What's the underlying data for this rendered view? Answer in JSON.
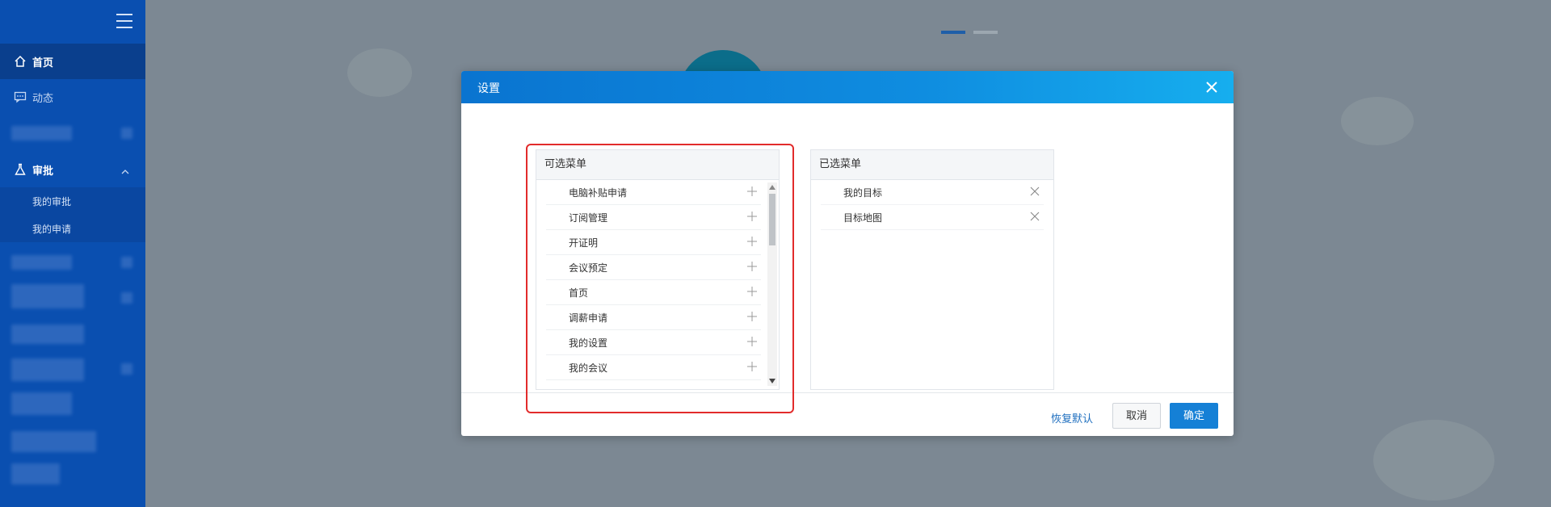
{
  "sidebar": {
    "items": [
      {
        "label": "首页",
        "icon": "home-icon"
      },
      {
        "label": "动态",
        "icon": "chat-icon"
      }
    ],
    "group": {
      "label": "审批",
      "icon": "flask-icon"
    },
    "sub_items": [
      {
        "label": "我的审批"
      },
      {
        "label": "我的申请"
      }
    ]
  },
  "dialog": {
    "title": "设置",
    "available_menu": {
      "header": "可选菜单",
      "items": [
        {
          "label": "电脑补贴申请"
        },
        {
          "label": "订阅管理"
        },
        {
          "label": "开证明"
        },
        {
          "label": "会议预定"
        },
        {
          "label": "首页"
        },
        {
          "label": "调薪申请"
        },
        {
          "label": "我的设置"
        },
        {
          "label": "我的会议"
        }
      ]
    },
    "selected_menu": {
      "header": "已选菜单",
      "items": [
        {
          "label": "我的目标"
        },
        {
          "label": "目标地图"
        }
      ]
    },
    "footer": {
      "restore_label": "恢复默认",
      "cancel_label": "取消",
      "ok_label": "确定"
    }
  },
  "colors": {
    "sidebar": "#0a4fb0",
    "header_gradient_start": "#0a74d0",
    "header_gradient_end": "#16aeee",
    "highlight": "#e22b2b",
    "primary_button": "#1580d6"
  }
}
